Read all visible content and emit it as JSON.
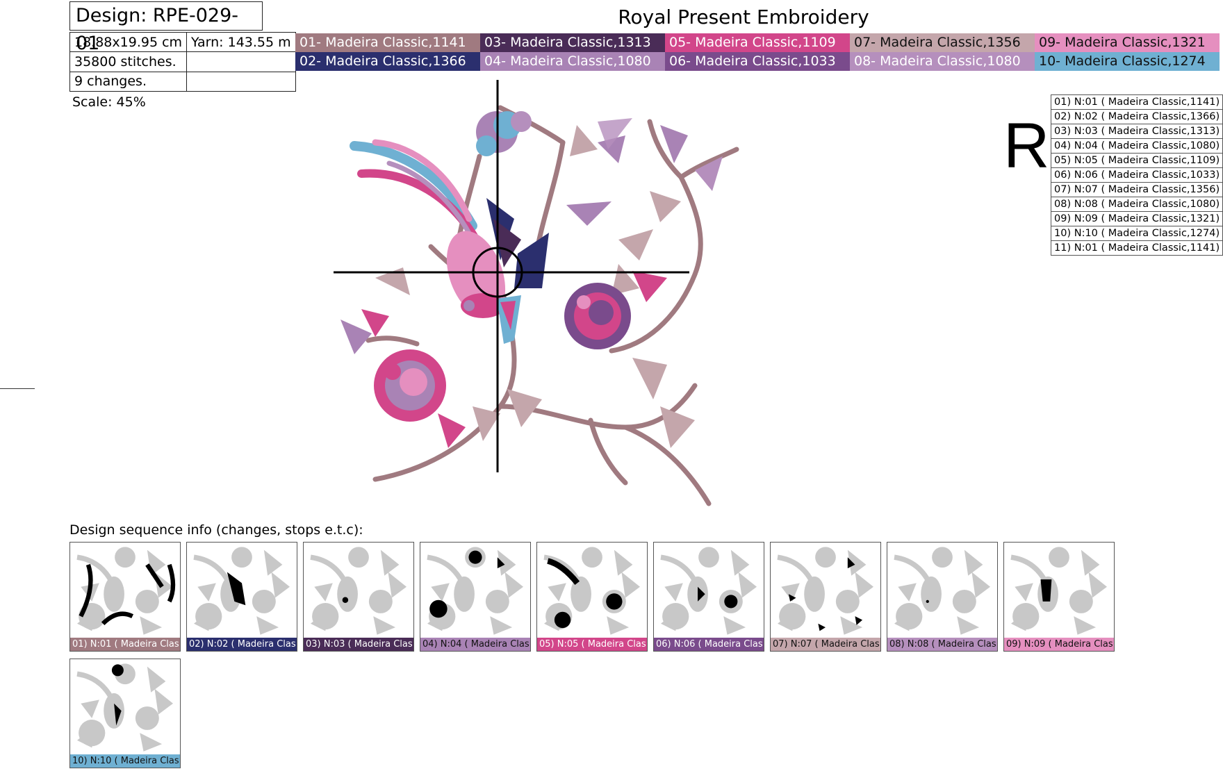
{
  "header": {
    "design_id": "Design: RPE-029-01",
    "brand": "Royal Present Embroidery"
  },
  "info": {
    "size": "18.88x19.95 cm",
    "yarn": "Yarn: 143.55 m",
    "stitches": "35800 stitches.",
    "changes": "9 changes.",
    "scale": "Scale: 45%"
  },
  "colors": [
    {
      "label": "01- Madeira Classic,1141",
      "hex": "#a07a80",
      "text": "#ffffff"
    },
    {
      "label": "03- Madeira Classic,1313",
      "hex": "#4a2c57",
      "text": "#ffffff"
    },
    {
      "label": "05- Madeira Classic,1109",
      "hex": "#d2468a",
      "text": "#ffffff"
    },
    {
      "label": "07- Madeira Classic,1356",
      "hex": "#c4a6ab",
      "text": "#111111"
    },
    {
      "label": "09- Madeira Classic,1321",
      "hex": "#e58fbf",
      "text": "#111111"
    },
    {
      "label": "02- Madeira Classic,1366",
      "hex": "#2b2f6e",
      "text": "#ffffff"
    },
    {
      "label": "04- Madeira Classic,1080",
      "hex": "#a983b5",
      "text": "#ffffff"
    },
    {
      "label": "06- Madeira Classic,1033",
      "hex": "#7a4b8c",
      "text": "#ffffff"
    },
    {
      "label": "08- Madeira Classic,1080",
      "hex": "#b58fbd",
      "text": "#ffffff"
    },
    {
      "label": "10- Madeira Classic,1274",
      "hex": "#6fb0d2",
      "text": "#111111"
    }
  ],
  "sequence_marker": "R",
  "sequence_list": [
    "01) N:01 ( Madeira Classic,1141)",
    "02) N:02 ( Madeira Classic,1366)",
    "03) N:03 ( Madeira Classic,1313)",
    "04) N:04 ( Madeira Classic,1080)",
    "05) N:05 ( Madeira Classic,1109)",
    "06) N:06 ( Madeira Classic,1033)",
    "07) N:07 ( Madeira Classic,1356)",
    "08) N:08 ( Madeira Classic,1080)",
    "09) N:09 ( Madeira Classic,1321)",
    "10) N:10 ( Madeira Classic,1274)",
    "11) N:01 ( Madeira Classic,1141)"
  ],
  "sequence_title": "Design sequence info (changes, stops e.t.c):",
  "thumbnails": [
    {
      "label": "01) N:01 ( Madeira Clas",
      "hex": "#a07a80",
      "text": "#ffffff"
    },
    {
      "label": "02) N:02 ( Madeira Clas",
      "hex": "#2b2f6e",
      "text": "#ffffff"
    },
    {
      "label": "03) N:03 ( Madeira Clas",
      "hex": "#4a2c57",
      "text": "#ffffff"
    },
    {
      "label": "04) N:04 ( Madeira Clas",
      "hex": "#a983b5",
      "text": "#111111"
    },
    {
      "label": "05) N:05 ( Madeira Clas",
      "hex": "#d2468a",
      "text": "#ffffff"
    },
    {
      "label": "06) N:06 ( Madeira Clas",
      "hex": "#7a4b8c",
      "text": "#ffffff"
    },
    {
      "label": "07) N:07 ( Madeira Clas",
      "hex": "#c4a6ab",
      "text": "#111111"
    },
    {
      "label": "08) N:08 ( Madeira Clas",
      "hex": "#b58fbd",
      "text": "#111111"
    },
    {
      "label": "09) N:09 ( Madeira Clas",
      "hex": "#e58fbf",
      "text": "#111111"
    },
    {
      "label": "10) N:10 ( Madeira Clas",
      "hex": "#6fb0d2",
      "text": "#111111"
    }
  ]
}
